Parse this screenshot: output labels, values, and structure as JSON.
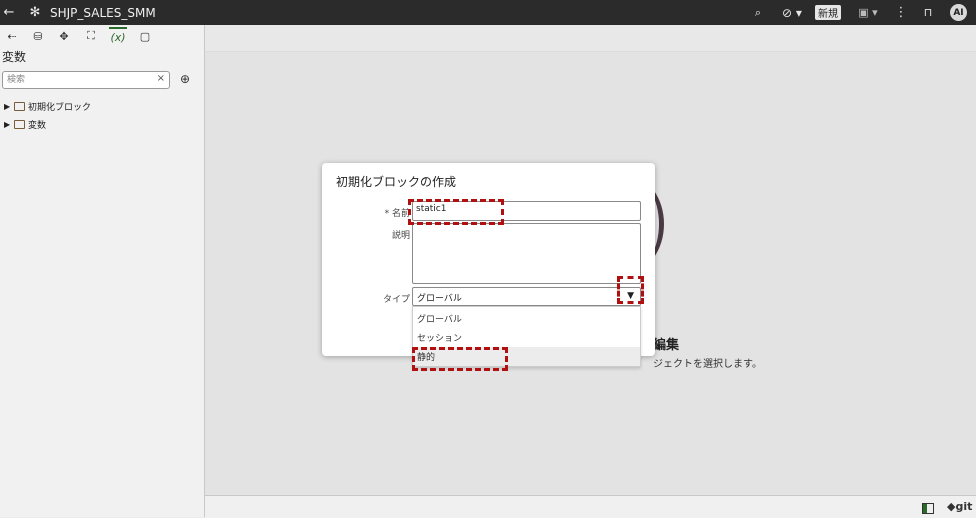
{
  "topbar": {
    "back_icon": "←",
    "app_icon": "✻",
    "title": "SHJP_SALES_SMM",
    "search_icon": "⌕",
    "check_icon": "⊘ ▾",
    "new_label": "新規",
    "save_icon": "▣ ▾",
    "menu_icon": "⋮",
    "bookmark_icon": "⊓",
    "avatar": "AI"
  },
  "left_panel": {
    "tools": [
      "⇠",
      "⛁",
      "✥",
      "⛶",
      "(x)",
      "▢"
    ],
    "title": "変数",
    "search_placeholder": "検索",
    "clear": "×",
    "add": "⊕",
    "tree": [
      {
        "label": "初期化ブロック"
      },
      {
        "label": "変数"
      }
    ]
  },
  "background": {
    "title_fragment": "編集",
    "subtitle_fragment": "ジェクトを選択します。"
  },
  "dialog": {
    "title": "初期化ブロックの作成",
    "name_label": "名前",
    "required": "*",
    "name_value": "static1",
    "desc_label": "説明",
    "type_label": "タイプ",
    "type_value": "グローバル",
    "caret": "▼",
    "options": [
      "グローバル",
      "セッション",
      "静的"
    ]
  },
  "bottom": {
    "git": "◆git"
  },
  "colors": {
    "topbar": "#2b2b2b",
    "highlight_mark": "#b01010",
    "accent": "#2a6a2a"
  }
}
